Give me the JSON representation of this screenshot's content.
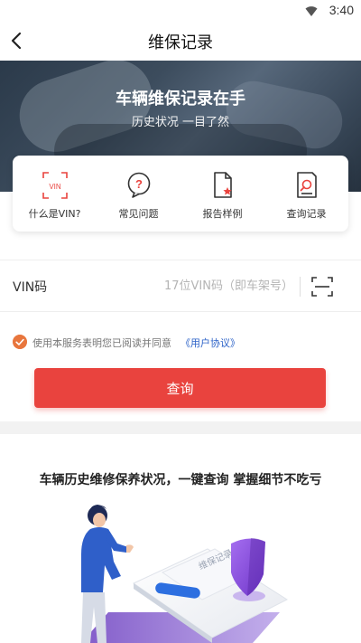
{
  "status_bar": {
    "time": "3:40",
    "icons": [
      "wifi-icon"
    ]
  },
  "header": {
    "title": "维保记录",
    "back_icon": "back-arrow-icon"
  },
  "banner": {
    "title": "车辆维保记录在手",
    "subtitle": "历史状况 一目了然"
  },
  "shortcuts": [
    {
      "label": "什么是VIN?",
      "icon": "vin-scan-icon"
    },
    {
      "label": "常见问题",
      "icon": "question-bubble-icon"
    },
    {
      "label": "报告样例",
      "icon": "report-document-icon"
    },
    {
      "label": "查询记录",
      "icon": "search-record-icon"
    }
  ],
  "vin": {
    "label": "VIN码",
    "value": "",
    "placeholder": "17位VIN码（即车架号）",
    "scan_icon": "scan-icon"
  },
  "agreement": {
    "checked": true,
    "text": "使用本服务表明您已阅读并同意",
    "link": "《用户协议》"
  },
  "query_button": {
    "label": "查询"
  },
  "promo": {
    "title": "车辆历史维修保养状况，一键查询 掌握细节不吃亏",
    "card_title": "维保记录"
  },
  "colors": {
    "accent": "#e9433e",
    "check": "#e8763d",
    "link": "#2d63c8",
    "shield": "#8e4fd6"
  }
}
